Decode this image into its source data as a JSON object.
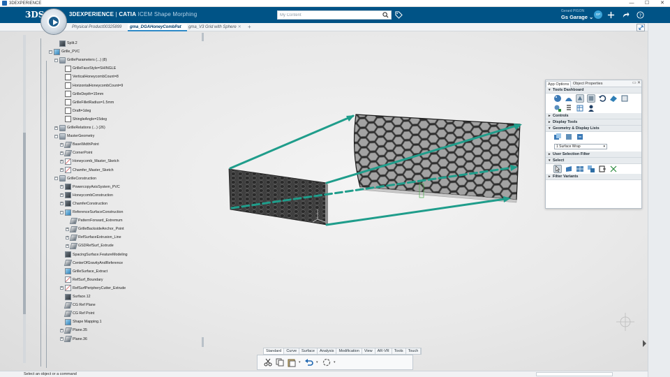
{
  "window": {
    "title": "3DEXPERIENCE",
    "controls": [
      "—",
      "☐",
      "✕"
    ]
  },
  "header": {
    "brand": "3DEXPERIENCE",
    "separator": " | ",
    "app": "CATIA",
    "module": "ICEM Shape Morphing",
    "search_placeholder": "My Content",
    "user_name": "Gerard PIGON",
    "space": "Gs Garage ⌄",
    "avatar_initials": "GP"
  },
  "tabs": [
    {
      "label": "Physical Product00325899",
      "active": false
    },
    {
      "label": "gma_DGAHoneyCombPat",
      "active": true
    },
    {
      "label": "gma_V3 Grid with Sphere",
      "active": false
    }
  ],
  "tree": {
    "nodes": [
      {
        "label": "Split.2",
        "depth": 1,
        "icon": "dark",
        "exp": ""
      },
      {
        "label": "Grille_PVC",
        "depth": 0,
        "icon": "blue",
        "exp": "−"
      },
      {
        "label": "GrilleParameters (...) (8)",
        "depth": 1,
        "icon": "folder",
        "exp": "−"
      },
      {
        "label": "GrilleFaceStyle=SHINGLE",
        "depth": 2,
        "icon": "param",
        "exp": ""
      },
      {
        "label": "VerticalHoneycombCount=8",
        "depth": 2,
        "icon": "param",
        "exp": ""
      },
      {
        "label": "HorizontalHoneycombCount=9",
        "depth": 2,
        "icon": "param",
        "exp": ""
      },
      {
        "label": "GrilleDepth=15mm",
        "depth": 2,
        "icon": "param",
        "exp": ""
      },
      {
        "label": "GrilleFilletRadius=1.5mm",
        "depth": 2,
        "icon": "param",
        "exp": ""
      },
      {
        "label": "Draft=1deg",
        "depth": 2,
        "icon": "param",
        "exp": ""
      },
      {
        "label": "ShingleAngle=15deg",
        "depth": 2,
        "icon": "param",
        "exp": ""
      },
      {
        "label": "GrilleRelations (...) (26)",
        "depth": 1,
        "icon": "folder",
        "exp": "+"
      },
      {
        "label": "MasterGeometry",
        "depth": 1,
        "icon": "folder",
        "exp": "−"
      },
      {
        "label": "BaseWidthPoint",
        "depth": 2,
        "icon": "plane",
        "exp": "+"
      },
      {
        "label": "CornerPoint",
        "depth": 2,
        "icon": "plane",
        "exp": "+"
      },
      {
        "label": "Honeycomb_Master_Sketch",
        "depth": 2,
        "icon": "sketch",
        "exp": "+"
      },
      {
        "label": "Chamfer_Master_Sketch",
        "depth": 2,
        "icon": "sketch",
        "exp": "+"
      },
      {
        "label": "GrilleConstruction",
        "depth": 1,
        "icon": "folder",
        "exp": "−"
      },
      {
        "label": "PowercopyAxisSystem_PVC",
        "depth": 2,
        "icon": "dark",
        "exp": "+"
      },
      {
        "label": "HoneycombConstruction",
        "depth": 2,
        "icon": "dark",
        "exp": "+"
      },
      {
        "label": "ChamferConstruction",
        "depth": 2,
        "icon": "dark",
        "exp": "+"
      },
      {
        "label": "ReferenceSurfaceConstruction",
        "depth": 2,
        "icon": "blue",
        "exp": "−"
      },
      {
        "label": "PatternForward_Extremum",
        "depth": 3,
        "icon": "plane",
        "exp": ""
      },
      {
        "label": "GrilleBacksideAnchor_Point",
        "depth": 3,
        "icon": "plane",
        "exp": "+"
      },
      {
        "label": "RefSurfaceExtrusion_Line",
        "depth": 3,
        "icon": "plane",
        "exp": "+"
      },
      {
        "label": "GSDRefSurf_Extrude",
        "depth": 3,
        "icon": "plane",
        "exp": "+"
      },
      {
        "label": "SpacingSurface.FeatureModeling",
        "depth": 2,
        "icon": "dark",
        "exp": ""
      },
      {
        "label": "CenterOfGravityAndReference",
        "depth": 2,
        "icon": "plane",
        "exp": ""
      },
      {
        "label": "GrilleSurface_Extract",
        "depth": 2,
        "icon": "blue",
        "exp": ""
      },
      {
        "label": "RefSurf_Boundary",
        "depth": 2,
        "icon": "sketch",
        "exp": ""
      },
      {
        "label": "RefSurfPeripheryCutter_Extrude",
        "depth": 2,
        "icon": "sketch",
        "exp": "+"
      },
      {
        "label": "Surface.12",
        "depth": 2,
        "icon": "dark",
        "exp": ""
      },
      {
        "label": "CG Ref Plane",
        "depth": 2,
        "icon": "plane",
        "exp": ""
      },
      {
        "label": "CG Ref Point",
        "depth": 2,
        "icon": "plane",
        "exp": ""
      },
      {
        "label": "Shape Mapping.1",
        "depth": 2,
        "icon": "blue",
        "exp": ""
      },
      {
        "label": "Plane.35",
        "depth": 2,
        "icon": "plane",
        "exp": "+"
      },
      {
        "label": "Plane.36",
        "depth": 2,
        "icon": "plane",
        "exp": "+"
      }
    ]
  },
  "panel": {
    "tabs": [
      "App Options",
      "Object Properties"
    ],
    "sections": {
      "tools_dashboard": "Tools Dashboard",
      "controls": "Controls",
      "display_tools": "Display Tools",
      "geometry_lists": "Geometry & Display Lists",
      "surface_wrap": "1 Surface Wrap",
      "user_selection_filter": "User Selection Filter",
      "select": "Select",
      "filter_variants": "Filter Variants"
    }
  },
  "command_tabs": [
    "Standard",
    "Curve",
    "Surface",
    "Analysis",
    "Modification",
    "View",
    "AR-VR",
    "Tools",
    "Touch"
  ],
  "status": {
    "message": "Select an object or a command"
  },
  "colors": {
    "topbar": "#005386",
    "arrow": "#1f9d8b",
    "grille_dark": "#3c3c3c",
    "grille_light": "#9a9a9a"
  }
}
